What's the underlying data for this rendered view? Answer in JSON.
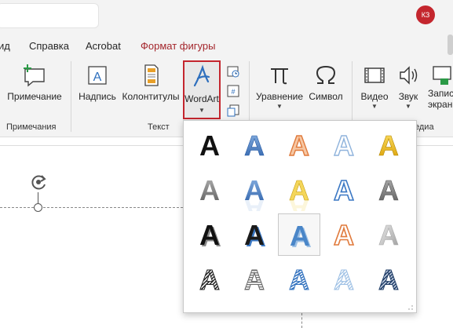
{
  "titlebar": {
    "avatar_initials": "КЗ"
  },
  "tabs": [
    {
      "label": "ид",
      "active": false
    },
    {
      "label": "Справка",
      "active": false
    },
    {
      "label": "Acrobat",
      "active": false
    },
    {
      "label": "Формат фигуры",
      "active": true
    }
  ],
  "ribbon": {
    "comment": "Примечание",
    "group_comments": "Примечания",
    "textbox": "Надпись",
    "header_footer": "Колонтитулы",
    "wordart": "WordArt",
    "group_text": "Текст",
    "equation": "Уравнение",
    "symbol": "Символ",
    "video": "Видео",
    "audio": "Звук",
    "screen_record_line1": "Запис",
    "screen_record_line2": "экран",
    "group_media_partial": "едиа"
  },
  "gallery": {
    "glyph": "A",
    "selected_index": 12,
    "styles": [
      "black-fill",
      "blue-gradient",
      "orange-outline",
      "blue-outline",
      "gold-gradient",
      "gray-gradient",
      "blue-reflection",
      "gold-reflection",
      "blue-outline-2",
      "gray-bevel",
      "black-outline",
      "black-shadow",
      "blue-fill-shadow",
      "orange-outline-2",
      "silver-bevel",
      "striped-black",
      "striped-gray",
      "striped-blue",
      "hatched-light-blue",
      "hatched-navy"
    ]
  },
  "colors": {
    "accent": "#c4262e",
    "active_tab": "#a4262c",
    "blue": "#3b78c4",
    "orange": "#e07a3c",
    "gold": "#e8b200"
  }
}
